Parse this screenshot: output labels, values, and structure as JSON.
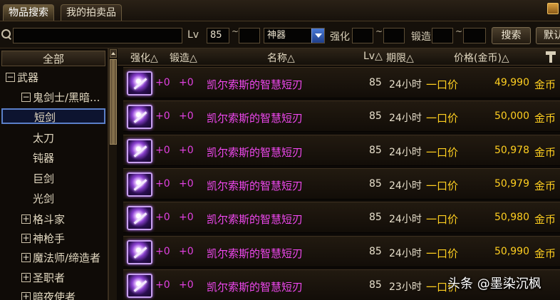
{
  "tabs": [
    {
      "label": "物品搜索",
      "active": true
    },
    {
      "label": "我的拍卖品",
      "active": false
    }
  ],
  "search": {
    "keyword_value": "",
    "lv_label": "Lv",
    "lv_min": "85",
    "lv_max": "",
    "tilde": "~",
    "type_value": "神器",
    "strengthen_label": "强化",
    "strengthen_min": "",
    "strengthen_max": "",
    "forge_label": "锻造",
    "forge_min": "",
    "forge_max": "",
    "search_button": "搜索",
    "default_button": "默认"
  },
  "sidebar": {
    "all_label": "全部",
    "weapon": {
      "toggle": "−",
      "label": "武器"
    },
    "ghost": {
      "toggle": "−",
      "label": "鬼剑士/黑暗..."
    },
    "items": [
      {
        "label": "短剑"
      },
      {
        "label": "太刀"
      },
      {
        "label": "钝器"
      },
      {
        "label": "巨剑"
      },
      {
        "label": "光剑"
      }
    ],
    "classes": [
      {
        "toggle": "+",
        "label": "格斗家"
      },
      {
        "toggle": "+",
        "label": "神枪手"
      },
      {
        "toggle": "+",
        "label": "魔法师/缔造者"
      },
      {
        "toggle": "+",
        "label": "圣职者"
      },
      {
        "toggle": "+",
        "label": "暗夜使者"
      }
    ]
  },
  "columns": {
    "strengthen": "强化△",
    "forge": "锻造△",
    "name": "名称△",
    "lv": "Lv△",
    "period": "期限△",
    "price": "价格(金币)△"
  },
  "rows": [
    {
      "str": "+0",
      "lock": "+0",
      "name": "凯尔索斯的智慧短刃",
      "lv": "85",
      "time": "24小时",
      "type": "一口价",
      "price": "49,990",
      "unit": "金币"
    },
    {
      "str": "+0",
      "lock": "+0",
      "name": "凯尔索斯的智慧短刃",
      "lv": "85",
      "time": "24小时",
      "type": "一口价",
      "price": "50,000",
      "unit": "金币"
    },
    {
      "str": "+0",
      "lock": "+0",
      "name": "凯尔索斯的智慧短刃",
      "lv": "85",
      "time": "24小时",
      "type": "一口价",
      "price": "50,978",
      "unit": "金币"
    },
    {
      "str": "+0",
      "lock": "+0",
      "name": "凯尔索斯的智慧短刃",
      "lv": "85",
      "time": "24小时",
      "type": "一口价",
      "price": "50,979",
      "unit": "金币"
    },
    {
      "str": "+0",
      "lock": "+0",
      "name": "凯尔索斯的智慧短刃",
      "lv": "85",
      "time": "24小时",
      "type": "一口价",
      "price": "50,980",
      "unit": "金币"
    },
    {
      "str": "+0",
      "lock": "+0",
      "name": "凯尔索斯的智慧短刃",
      "lv": "85",
      "time": "24小时",
      "type": "一口价",
      "price": "50,990",
      "unit": "金币"
    },
    {
      "str": "+0",
      "lock": "+0",
      "name": "凯尔索斯的智慧短刃",
      "lv": "85",
      "time": "23小时",
      "type": "一口价",
      "price": "",
      "unit": ""
    }
  ],
  "watermark": "头条 @墨染沉枫"
}
